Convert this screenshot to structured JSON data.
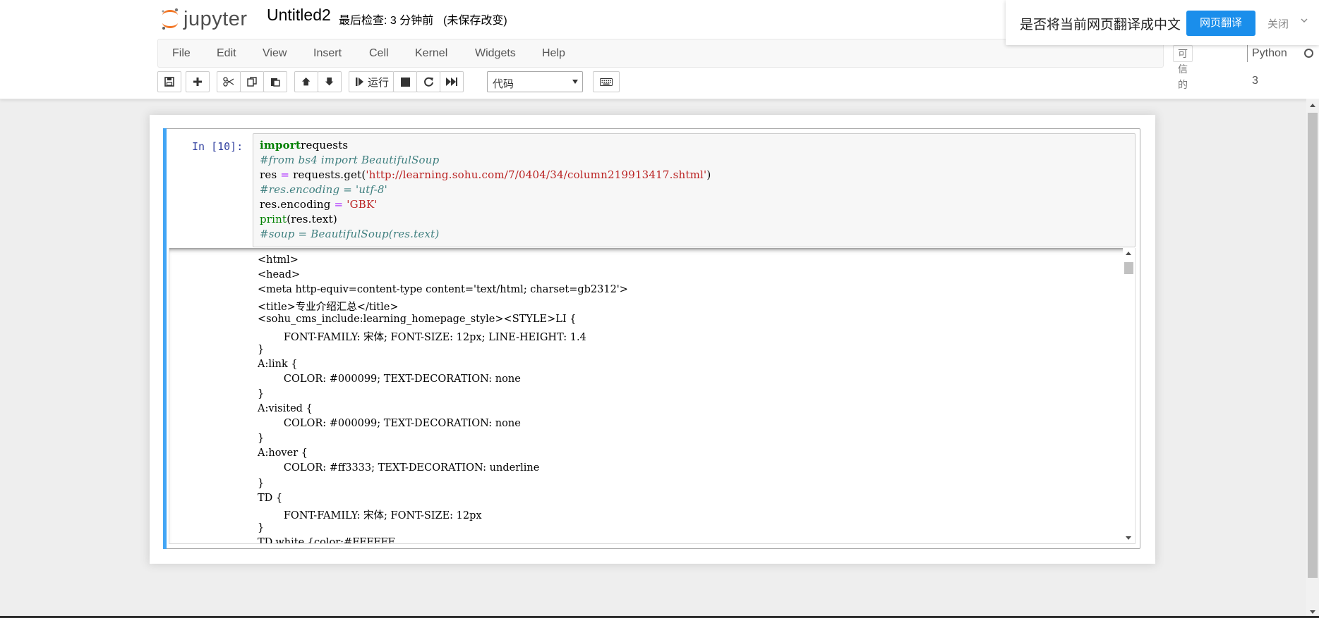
{
  "header": {
    "logo_text": "jupyter",
    "notebook_title": "Untitled2",
    "checkpoint": "最后检查: 3 分钟前",
    "autosave": "(未保存改变)"
  },
  "menu": {
    "items": [
      "File",
      "Edit",
      "View",
      "Insert",
      "Cell",
      "Kernel",
      "Widgets",
      "Help"
    ],
    "trusted": "可信的",
    "kernel_name": "Python 3"
  },
  "toolbar": {
    "run_label": "运行",
    "cell_type": "代码"
  },
  "translate_popup": {
    "prompt": "是否将当前网页翻译成中文",
    "translate_button": "网页翻译",
    "close": "关闭"
  },
  "cell": {
    "prompt": "In  [10]:",
    "code": [
      [
        [
          "kw",
          "import"
        ],
        [
          "",
          "requests"
        ]
      ],
      [
        [
          "cm",
          "#from bs4 import BeautifulSoup"
        ]
      ],
      [
        [
          "",
          "res "
        ],
        [
          "op",
          "="
        ],
        [
          "",
          " requests.get("
        ],
        [
          "str",
          "'http://learning.sohu.com/7/0404/34/column219913417.shtml'"
        ],
        [
          "",
          ")"
        ]
      ],
      [
        [
          "cm",
          "#res.encoding = 'utf-8'"
        ]
      ],
      [
        [
          "",
          "res.encoding "
        ],
        [
          "op",
          "="
        ],
        [
          "",
          " "
        ],
        [
          "str",
          "'GBK'"
        ]
      ],
      [
        [
          "bi",
          "print"
        ],
        [
          "",
          "(res.text)"
        ]
      ],
      [
        [
          "cm",
          "#soup = BeautifulSoup(res.text)"
        ]
      ]
    ],
    "output": [
      "<html>",
      "<head>",
      "<meta http-equiv=content-type content='text/html; charset=gb2312'>",
      "<title>专业介绍汇总</title>",
      "<sohu_cms_include:learning_homepage_style><STYLE>LI {",
      "        FONT-FAMILY: 宋体; FONT-SIZE: 12px; LINE-HEIGHT: 1.4",
      "}",
      "A:link {",
      "        COLOR: #000099; TEXT-DECORATION: none",
      "}",
      "A:visited {",
      "        COLOR: #000099; TEXT-DECORATION: none",
      "}",
      "A:hover {",
      "        COLOR: #ff3333; TEXT-DECORATION: underline",
      "}",
      "TD {",
      "        FONT-FAMILY: 宋体; FONT-SIZE: 12px",
      "}",
      "TD.white {color:#FFFFFF"
    ]
  },
  "colors": {
    "cell_selected_bar": "#42a5f5",
    "prompt": "#303f9f",
    "keyword": "#008000",
    "string": "#ba2121",
    "comment": "#408080",
    "operator": "#aa22ff",
    "translate_button": "#1a8eeb"
  }
}
